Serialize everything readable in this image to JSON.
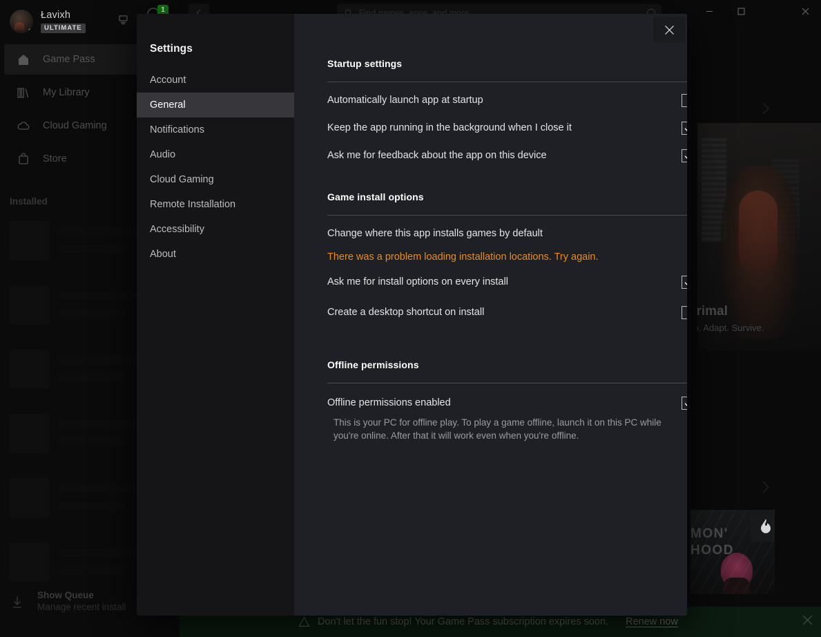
{
  "window": {
    "minimize_label": "Minimize",
    "maximize_label": "Maximize",
    "close_label": "Close"
  },
  "app": {
    "profile": {
      "name": "Łavixh",
      "tier": "ULTIMATE"
    },
    "notification_count": "1",
    "search_placeholder": "Find games, apps, and more",
    "nav_items": [
      {
        "label": "Game Pass",
        "icon": "home-icon",
        "active": true
      },
      {
        "label": "My Library",
        "icon": "library-icon",
        "active": false
      },
      {
        "label": "Cloud Gaming",
        "icon": "cloud-icon",
        "active": false
      },
      {
        "label": "Store",
        "icon": "store-icon",
        "active": false
      }
    ],
    "installed_label": "Installed",
    "queue": {
      "title": "Show Queue",
      "subtitle": "Manage recent install"
    },
    "hero": {
      "title": "Exoprimal",
      "subtitle": "Team up. Adapt. Survive."
    },
    "card": {
      "line1": "MON'",
      "line2": "HOOD"
    },
    "banner": {
      "message": "Don't let the fun stop! Your Game Pass subscription expires soon.",
      "link": "Renew now",
      "warning_icon": "warning-icon",
      "close_icon": "close-icon"
    }
  },
  "dialog": {
    "title": "Settings",
    "close_label": "Close",
    "nav": [
      {
        "label": "Account",
        "active": false
      },
      {
        "label": "General",
        "active": true
      },
      {
        "label": "Notifications",
        "active": false
      },
      {
        "label": "Audio",
        "active": false
      },
      {
        "label": "Cloud Gaming",
        "active": false
      },
      {
        "label": "Remote Installation",
        "active": false
      },
      {
        "label": "Accessibility",
        "active": false
      },
      {
        "label": "About",
        "active": false
      }
    ],
    "sections": {
      "startup": {
        "heading": "Startup settings",
        "rows": [
          {
            "label": "Automatically launch app at startup",
            "checked": false
          },
          {
            "label": "Keep the app running in the background when I close it",
            "checked": true
          },
          {
            "label": "Ask me for feedback about the app on this device",
            "checked": true
          }
        ]
      },
      "install": {
        "heading": "Game install options",
        "change_location_label": "Change where this app installs games by default",
        "error": "There was a problem loading installation locations. Try again.",
        "rows": [
          {
            "label": "Ask me for install options on every install",
            "checked": true
          },
          {
            "label": "Create a desktop shortcut on install",
            "checked": false
          }
        ]
      },
      "offline": {
        "heading": "Offline permissions",
        "row": {
          "label": "Offline permissions enabled",
          "checked": true
        },
        "description": "This is your PC for offline play. To play a game offline, launch it on this PC while you're online. After that it will work even when you're offline."
      }
    }
  },
  "colors": {
    "accent_green": "#107c10",
    "error_orange": "#e88c20",
    "dialog_bg": "#1f2025",
    "dialog_sidebar": "#151518",
    "nav_active": "#37373b"
  }
}
